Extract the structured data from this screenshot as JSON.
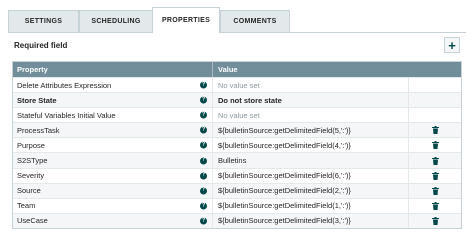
{
  "tabs": [
    {
      "label": "SETTINGS",
      "active": false
    },
    {
      "label": "SCHEDULING",
      "active": false
    },
    {
      "label": "PROPERTIES",
      "active": true
    },
    {
      "label": "COMMENTS",
      "active": false
    }
  ],
  "required_field_label": "Required field",
  "add_button_label": "+",
  "table": {
    "headers": {
      "property": "Property",
      "value": "Value"
    },
    "rows": [
      {
        "property": "Delete Attributes Expression",
        "value": "No value set",
        "required": false,
        "value_set": false,
        "deletable": false
      },
      {
        "property": "Store State",
        "value": "Do not store state",
        "required": true,
        "value_set": true,
        "deletable": false
      },
      {
        "property": "Stateful Variables Initial Value",
        "value": "No value set",
        "required": false,
        "value_set": false,
        "deletable": false
      },
      {
        "property": "ProcessTask",
        "value": "${bulletinSource:getDelimitedField(5,':')}",
        "required": false,
        "value_set": true,
        "deletable": true
      },
      {
        "property": "Purpose",
        "value": "${bulletinSource:getDelimitedField(4,':')}",
        "required": false,
        "value_set": true,
        "deletable": true
      },
      {
        "property": "S2SType",
        "value": "Bulletins",
        "required": false,
        "value_set": true,
        "deletable": true
      },
      {
        "property": "Severity",
        "value": "${bulletinSource:getDelimitedField(6,':')}",
        "required": false,
        "value_set": true,
        "deletable": true
      },
      {
        "property": "Source",
        "value": "${bulletinSource:getDelimitedField(2,':')}",
        "required": false,
        "value_set": true,
        "deletable": true
      },
      {
        "property": "Team",
        "value": "${bulletinSource:getDelimitedField(1,':')}",
        "required": false,
        "value_set": true,
        "deletable": true
      },
      {
        "property": "UseCase",
        "value": "${bulletinSource:getDelimitedField(3,':')}",
        "required": false,
        "value_set": true,
        "deletable": true
      }
    ]
  },
  "icons": {
    "help": "help-circle-icon",
    "delete": "trash-icon"
  },
  "colors": {
    "header_bg": "#728e9b",
    "accent": "#004849",
    "tab_bg": "#e3e8eb",
    "muted_text": "#8f9a9f"
  }
}
